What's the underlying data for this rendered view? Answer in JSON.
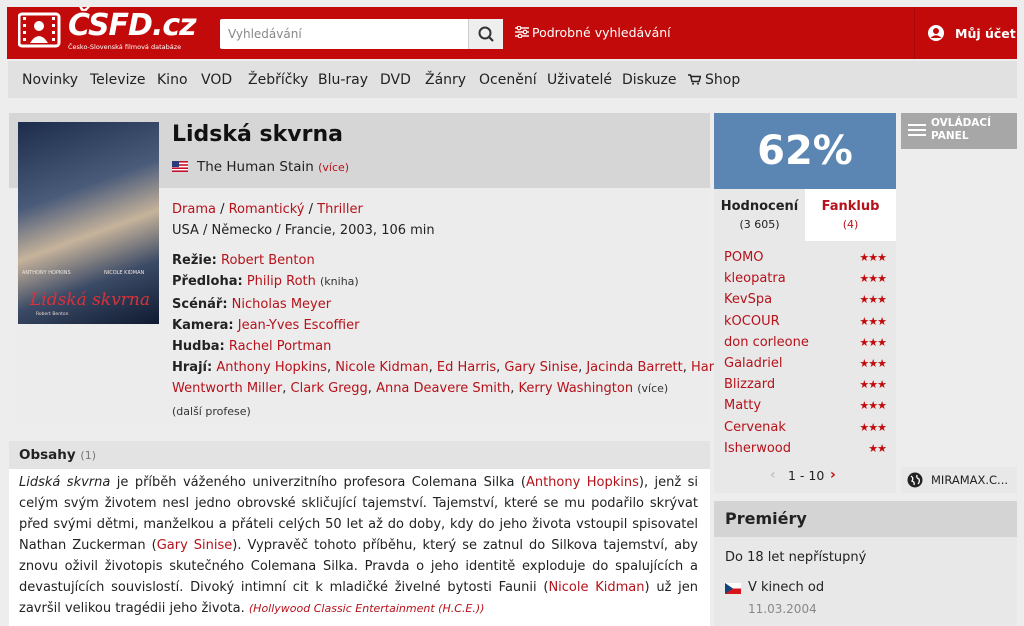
{
  "header": {
    "logo_text": "ČSFD.cz",
    "logo_subtitle": "Česko-Slovenská filmová databáze",
    "search_placeholder": "Vyhledávání",
    "advanced_search": "Podrobné vyhledávání",
    "account": "Můj účet",
    "brand_color": "#c30a0a"
  },
  "nav": {
    "items": [
      "Novinky",
      "Televize",
      "Kino",
      "VOD",
      "Žebříčky",
      "Blu-ray",
      "DVD",
      "Žánry",
      "Ocenění",
      "Uživatelé",
      "Diskuze",
      "Shop"
    ]
  },
  "film": {
    "title": "Lidská skvrna",
    "poster": {
      "actor1": "ANTHONY HOPKINS",
      "actor2": "NICOLE KIDMAN",
      "title": "Lidská skvrna",
      "tagline": "Robert Benton"
    },
    "alt_title": "The Human Stain",
    "alt_more": "(více)",
    "genres": [
      "Drama",
      "Romantický",
      "Thriller"
    ],
    "origin": "USA / Německo / Francie, 2003, 106 min",
    "director_label": "Režie:",
    "director": "Robert Benton",
    "source_label": "Předloha:",
    "source": "Philip Roth",
    "source_note": "(kniha)",
    "writer_label": "Scénář:",
    "writer": "Nicholas Meyer",
    "camera_label": "Kamera:",
    "camera": "Jean-Yves Escoffier",
    "music_label": "Hudba:",
    "music": "Rachel Portman",
    "cast_label": "Hrají:",
    "cast": [
      "Anthony Hopkins",
      "Nicole Kidman",
      "Ed Harris",
      "Gary Sinise",
      "Jacinda Barrett",
      "Harry Lennix",
      "Wentworth Miller",
      "Clark Gregg",
      "Anna Deavere Smith",
      "Kerry Washington"
    ],
    "cast_more": "(více)",
    "more_professions": "další profese"
  },
  "synopsis": {
    "title": "Obsahy",
    "count": "(1)",
    "t1": "Lidská skvrna",
    "t2": " je příběh váženého univerzitního profesora Colemana Silka (",
    "l1": "Anthony Hopkins",
    "t3": "), jenž si celým svým životem nesl jedno obrovské skličující tajemství. Tajemství, které se mu podařilo skrývat před svými dětmi, manželkou a přáteli celých 50 let až do doby, kdy do jeho života vstoupil spisovatel Nathan Zuckerman (",
    "l2": "Gary Sinise",
    "t4": "). Vypravěč tohoto příběhu, který se zatnul do Silkova tajemství, aby znovu oživil životopis skutečného Colemana Silka. Pravda o jeho identitě exploduje do spalujících a devastujících souvislostí. Divoký intimní cit k mladičké živelné bytosti Faunii (",
    "l3": "Nicole Kidman",
    "t5": ") už jen završil velikou tragédii jeho života.",
    "source": "(Hollywood Classic Entertainment (H.C.E.))"
  },
  "rating": {
    "value": "62%",
    "color": "#5b86b3",
    "tab_ratings": "Hodnocení",
    "tab_ratings_count": "(3 605)",
    "tab_fanclub": "Fanklub",
    "tab_fanclub_count": "(4)",
    "users": [
      {
        "name": "POMO",
        "stars": 3
      },
      {
        "name": "kleopatra",
        "stars": 3
      },
      {
        "name": "KevSpa",
        "stars": 3
      },
      {
        "name": "kOCOUR",
        "stars": 3
      },
      {
        "name": "don corleone",
        "stars": 3
      },
      {
        "name": "Galadriel",
        "stars": 3
      },
      {
        "name": "Blizzard",
        "stars": 3
      },
      {
        "name": "Matty",
        "stars": 3
      },
      {
        "name": "Cervenak",
        "stars": 3
      },
      {
        "name": "Isherwood",
        "stars": 2
      }
    ],
    "pager": "1 - 10"
  },
  "premieres": {
    "title": "Premiéry",
    "age": "Do 18 let nepřístupný",
    "cinema": "V kinech od",
    "date": "11.03.2004"
  },
  "sidebar": {
    "control_panel": "OVLÁDACÍ PANEL",
    "distributor": "MIRAMAX.C..."
  }
}
